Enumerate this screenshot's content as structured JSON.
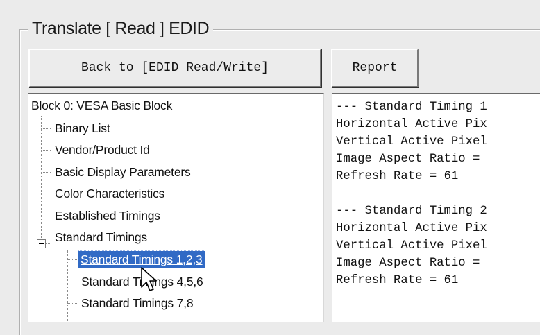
{
  "group_title": "Translate [ Read ] EDID",
  "buttons": {
    "back_label": "Back to [EDID Read/Write]",
    "report_label": "Report"
  },
  "tree": {
    "root": "Block 0: VESA Basic Block",
    "items": [
      "Binary List",
      "Vendor/Product Id",
      "Basic Display Parameters",
      "Color Characteristics",
      "Established Timings",
      "Standard Timings"
    ],
    "standard_timings_children": [
      "Standard Timings 1,2,3",
      "Standard Timings 4,5,6",
      "Standard Timings 7,8"
    ],
    "selected_item": "Standard Timings 1,2,3"
  },
  "report": {
    "lines": [
      "--- Standard Timing 1",
      "Horizontal Active Pix",
      "Vertical Active Pixel",
      "Image Aspect Ratio = ",
      "Refresh Rate = 61",
      "",
      "--- Standard Timing 2",
      "Horizontal Active Pix",
      "Vertical Active Pixel",
      "Image Aspect Ratio = ",
      "Refresh Rate = 61"
    ]
  },
  "colors": {
    "selection": "#316ac5",
    "window_bg": "#ebebeb"
  }
}
